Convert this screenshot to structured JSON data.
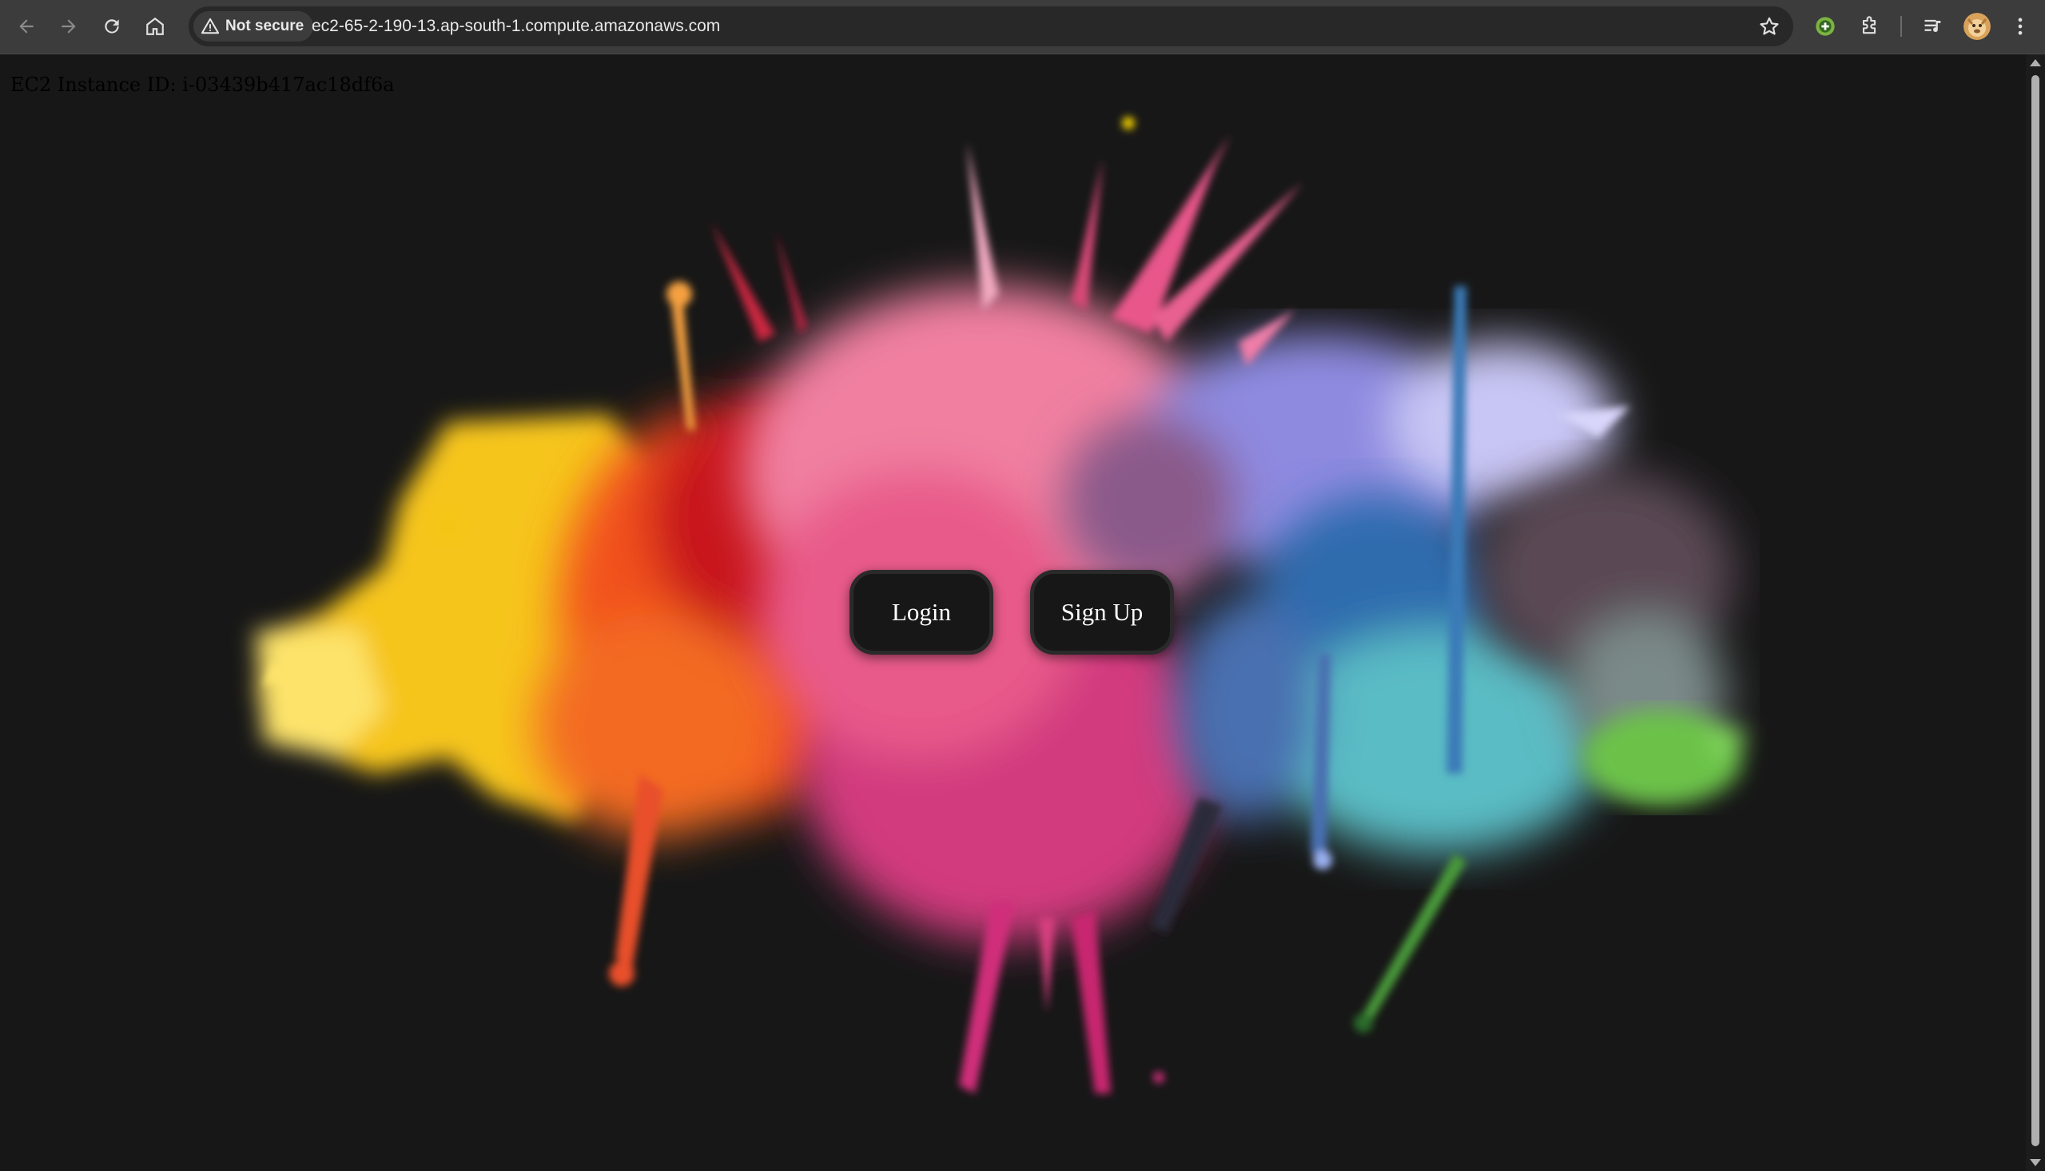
{
  "browser": {
    "security_label": "Not secure",
    "url": "ec2-65-2-190-13.ap-south-1.compute.amazonaws.com",
    "icons": [
      "back-arrow-icon",
      "forward-arrow-icon",
      "reload-icon",
      "home-icon",
      "warning-triangle-icon",
      "star-icon",
      "extension-plus-icon",
      "puzzle-icon",
      "media-queue-icon",
      "profile-avatar-icon",
      "kebab-menu-icon"
    ]
  },
  "page": {
    "instance_id": "EC2 Instance ID: i-03439b417ac18df6a",
    "login_label": "Login",
    "signup_label": "Sign Up"
  },
  "colors": {
    "background": "#171717",
    "button_bg": "#171717",
    "button_border": "#2a2a2a",
    "splash_yellow": "#f5c518",
    "splash_orange": "#f25c20",
    "splash_red": "#e52a2a",
    "splash_pink": "#e84a8a",
    "splash_magenta": "#d02f7a",
    "splash_purple": "#8a7ad8",
    "splash_blue": "#2e6fb0",
    "splash_teal": "#4fb3b8",
    "splash_green": "#6cc24a",
    "splash_grey": "#5a4a55"
  }
}
